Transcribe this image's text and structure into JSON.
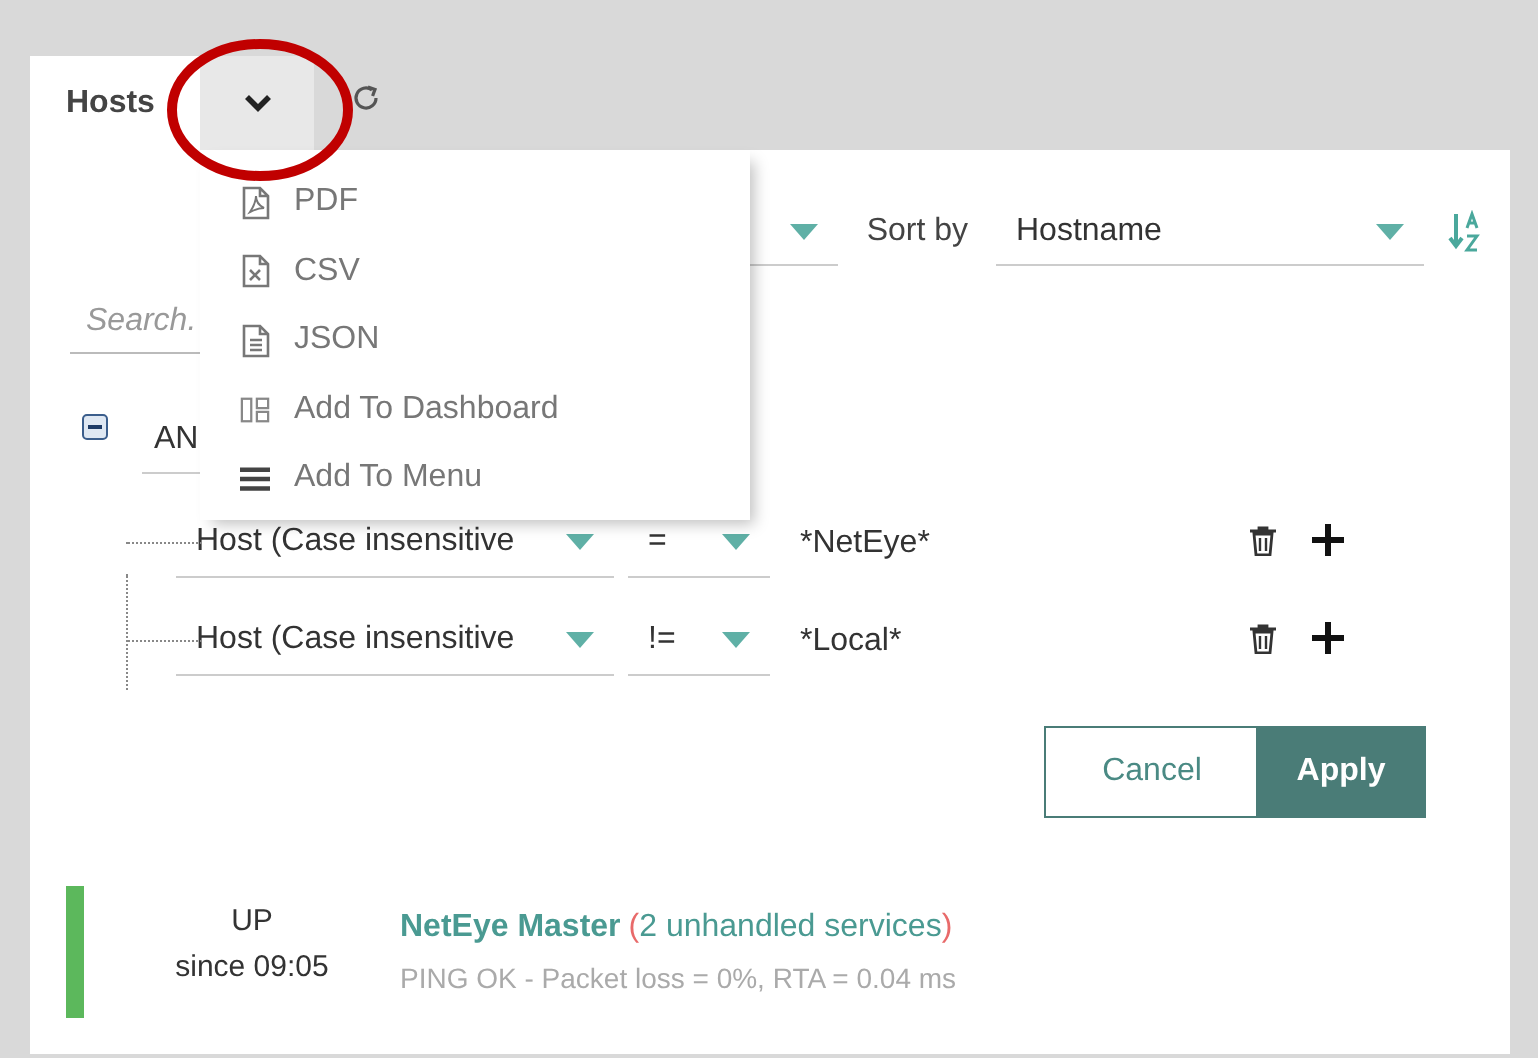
{
  "tabs": [
    {
      "label": "Hosts",
      "selected": true
    }
  ],
  "export_menu": {
    "open": true,
    "items": [
      {
        "kind": "pdf",
        "label": "PDF"
      },
      {
        "kind": "csv",
        "label": "CSV"
      },
      {
        "kind": "json",
        "label": "JSON"
      },
      {
        "kind": "dashboard",
        "label": "Add To Dashboard"
      },
      {
        "kind": "menu",
        "label": "Add To Menu"
      }
    ]
  },
  "toolbar": {
    "sort_label": "Sort by",
    "sort_value": "Hostname"
  },
  "search": {
    "placeholder": "Search."
  },
  "filter": {
    "operator": "AN",
    "expanded": true,
    "rules": [
      {
        "field": "Host (Case insensitive",
        "op": "=",
        "value": "*NetEye*"
      },
      {
        "field": "Host (Case insensitive",
        "op": "!=",
        "value": "*Local*"
      }
    ]
  },
  "buttons": [
    {
      "kind": "secondary",
      "label": "Cancel"
    },
    {
      "kind": "primary",
      "label": "Apply"
    }
  ],
  "hosts": [
    {
      "kind": "up",
      "state_label": "UP",
      "since": "since 09:05",
      "name": "NetEye Master",
      "paren_open": "(",
      "services": "2 unhandled services",
      "paren_close": ")",
      "output": "PING OK - Packet loss = 0%, RTA = 0.04 ms"
    }
  ]
}
